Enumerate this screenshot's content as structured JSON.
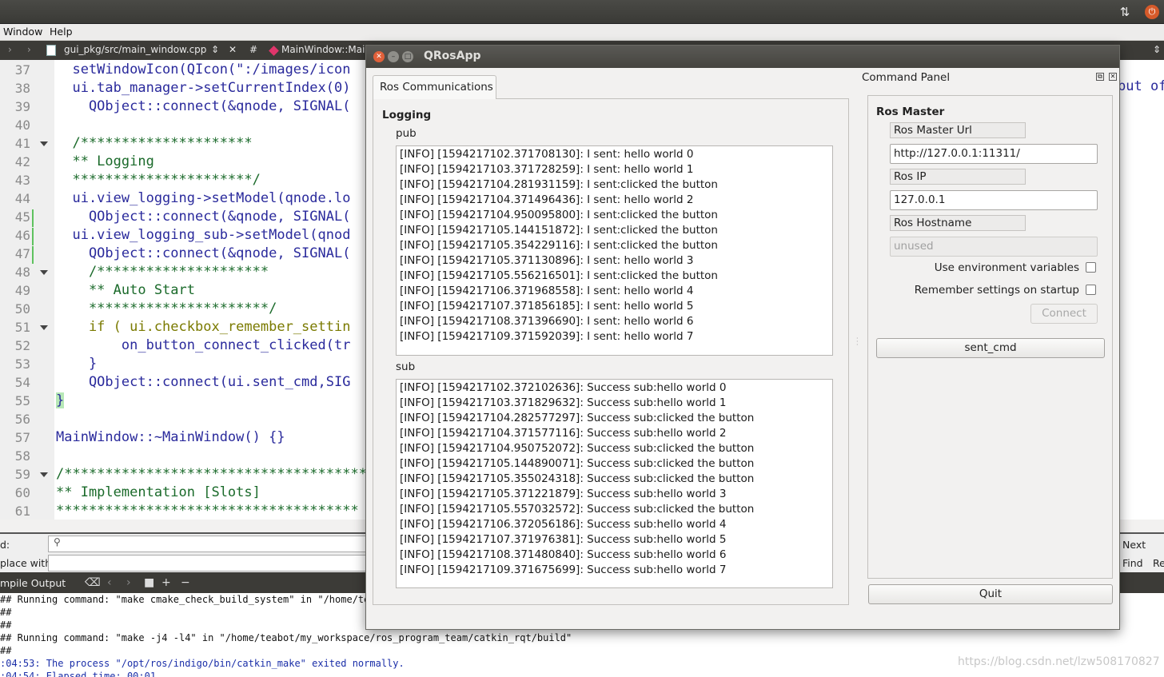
{
  "ide": {
    "menus": [
      "Window",
      "Help"
    ],
    "file_tab": "gui_pkg/src/main_window.cpp",
    "symbol_tab_hash": "#",
    "symbol_tab": "MainWindow::MainW",
    "code_lines": [
      {
        "n": "37",
        "text": "  setWindowIcon(QIcon(\":/images/icon"
      },
      {
        "n": "38",
        "text": "  ui.tab_manager->setCurrentIndex(0)"
      },
      {
        "n": "39",
        "text": "    QObject::connect(&qnode, SIGNAL("
      },
      {
        "n": "40",
        "text": ""
      },
      {
        "n": "41",
        "text": "  /*********************"
      },
      {
        "n": "42",
        "text": "  ** Logging"
      },
      {
        "n": "43",
        "text": "  **********************/"
      },
      {
        "n": "44",
        "text": "  ui.view_logging->setModel(qnode.lo"
      },
      {
        "n": "45",
        "text": "    QObject::connect(&qnode, SIGNAL("
      },
      {
        "n": "46",
        "text": "  ui.view_logging_sub->setModel(qnod"
      },
      {
        "n": "47",
        "text": "    QObject::connect(&qnode, SIGNAL("
      },
      {
        "n": "48",
        "text": "    /*********************"
      },
      {
        "n": "49",
        "text": "    ** Auto Start"
      },
      {
        "n": "50",
        "text": "    **********************/"
      },
      {
        "n": "51",
        "text": "    if ( ui.checkbox_remember_settin"
      },
      {
        "n": "52",
        "text": "        on_button_connect_clicked(tr"
      },
      {
        "n": "53",
        "text": "    }"
      },
      {
        "n": "54",
        "text": "    QObject::connect(ui.sent_cmd,SIG"
      },
      {
        "n": "55",
        "text": "}"
      },
      {
        "n": "56",
        "text": ""
      },
      {
        "n": "57",
        "text": "MainWindow::~MainWindow() {}"
      },
      {
        "n": "58",
        "text": ""
      },
      {
        "n": "59",
        "text": "/*************************************"
      },
      {
        "n": "60",
        "text": "** Implementation [Slots]"
      },
      {
        "n": "61",
        "text": "*************************************"
      }
    ],
    "code_right_fragment": "but of",
    "find_label": "d:",
    "replace_label": "place with:",
    "find_next": "Next",
    "find_find": "Find",
    "find_re": "Re",
    "output_tab": "mpile Output",
    "output_lines": [
      "## Running command: \"make cmake_check_build_system\" in \"/home/te",
      "##",
      "##",
      "## Running command: \"make -j4 -l4\" in \"/home/teabot/my_workspace/ros_program_team/catkin_rqt/build\"",
      "##",
      ":04:53: The process \"/opt/ros/indigo/bin/catkin_make\" exited normally.",
      ":04:54: Elapsed time: 00:01."
    ],
    "watermark": "https://blog.csdn.net/lzw508170827"
  },
  "app": {
    "title": "QRosApp",
    "tab_label": "Ros Communications",
    "logging_title": "Logging",
    "pub_label": "pub",
    "sub_label": "sub",
    "pub_lines": [
      "[INFO] [1594217102.371708130]: I sent: hello world 0",
      "[INFO] [1594217103.371728259]: I sent: hello world 1",
      "[INFO] [1594217104.281931159]: I sent:clicked the button",
      "[INFO] [1594217104.371496436]: I sent: hello world 2",
      "[INFO] [1594217104.950095800]: I sent:clicked the button",
      "[INFO] [1594217105.144151872]: I sent:clicked the button",
      "[INFO] [1594217105.354229116]: I sent:clicked the button",
      "[INFO] [1594217105.371130896]: I sent: hello world 3",
      "[INFO] [1594217105.556216501]: I sent:clicked the button",
      "[INFO] [1594217106.371968558]: I sent: hello world 4",
      "[INFO] [1594217107.371856185]: I sent: hello world 5",
      "[INFO] [1594217108.371396690]: I sent: hello world 6",
      "[INFO] [1594217109.371592039]: I sent: hello world 7"
    ],
    "sub_lines": [
      "[INFO] [1594217102.372102636]: Success sub:hello world 0",
      "[INFO] [1594217103.371829632]: Success sub:hello world 1",
      "[INFO] [1594217104.282577297]: Success sub:clicked the button",
      "[INFO] [1594217104.371577116]: Success sub:hello world 2",
      "[INFO] [1594217104.950752072]: Success sub:clicked the button",
      "[INFO] [1594217105.144890071]: Success sub:clicked the button",
      "[INFO] [1594217105.355024318]: Success sub:clicked the button",
      "[INFO] [1594217105.371221879]: Success sub:hello world 3",
      "[INFO] [1594217105.557032572]: Success sub:clicked the button",
      "[INFO] [1594217106.372056186]: Success sub:hello world 4",
      "[INFO] [1594217107.371976381]: Success sub:hello world 5",
      "[INFO] [1594217108.371480840]: Success sub:hello world 6",
      "[INFO] [1594217109.371675699]: Success sub:hello world 7"
    ],
    "command_panel": {
      "title": "Command Panel",
      "ros_master_title": "Ros Master",
      "master_url_label": "Ros Master Url",
      "master_url_value": "http://127.0.0.1:11311/",
      "ros_ip_label": "Ros IP",
      "ros_ip_value": "127.0.0.1",
      "hostname_label": "Ros Hostname",
      "hostname_value": "unused",
      "use_env_label": "Use environment variables",
      "remember_label": "Remember settings on startup",
      "connect_label": "Connect",
      "sent_cmd_label": "sent_cmd",
      "quit_label": "Quit"
    }
  }
}
